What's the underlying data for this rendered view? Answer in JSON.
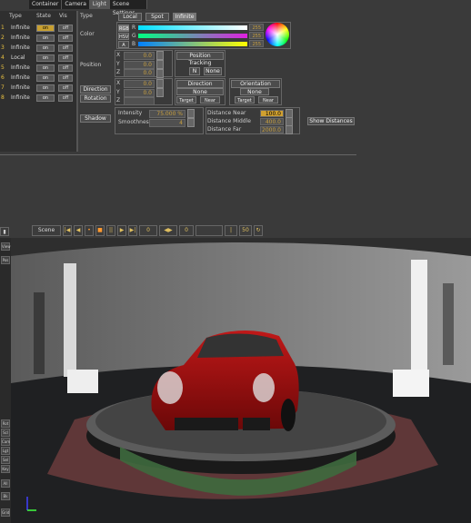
{
  "tabs": [
    {
      "label": "Container"
    },
    {
      "label": "Camera"
    },
    {
      "label": "Light"
    },
    {
      "label": "Scene Settings"
    }
  ],
  "light_list": {
    "headers": [
      "Type",
      "State",
      "Vis"
    ],
    "rows": [
      {
        "index": "1",
        "type": "Infinite",
        "state": "on",
        "vis": "off"
      },
      {
        "index": "2",
        "type": "Infinite",
        "state": "on",
        "vis": "off"
      },
      {
        "index": "3",
        "type": "Infinite",
        "state": "on",
        "vis": "off"
      },
      {
        "index": "4",
        "type": "Local",
        "state": "on",
        "vis": "off"
      },
      {
        "index": "5",
        "type": "Infinite",
        "state": "on",
        "vis": "off"
      },
      {
        "index": "6",
        "type": "Infinite",
        "state": "on",
        "vis": "off"
      },
      {
        "index": "7",
        "type": "Infinite",
        "state": "on",
        "vis": "off"
      },
      {
        "index": "8",
        "type": "Infinite",
        "state": "on",
        "vis": "off"
      }
    ]
  },
  "props": {
    "type_label": "Type",
    "type_buttons": [
      "Local",
      "Spot",
      "Infinite"
    ],
    "color_label": "Color",
    "color_modes": [
      "RGB",
      "HSV",
      "A"
    ],
    "color_channels": [
      {
        "name": "R",
        "value": "255"
      },
      {
        "name": "G",
        "value": "255"
      },
      {
        "name": "B",
        "value": "255"
      }
    ],
    "position_label": "Position",
    "position": {
      "x": "0.0",
      "y": "0.0",
      "z": "0.0"
    },
    "position_tracking_label": "Position Tracking",
    "position_tracking_buttons": [
      "N",
      "None"
    ],
    "direction_button": "Direction",
    "rotation_button": "Rotation",
    "rotation": {
      "x": "0.0",
      "y": "0.0",
      "z": ""
    },
    "direction_tracking_label": "Direction Tracking",
    "direction_tracking_value": "None",
    "direction_tracking_buttons": [
      "Target",
      "Near"
    ],
    "orientation_tracking_label": "Orientation Tracking",
    "orientation_tracking_value": "None",
    "orientation_tracking_buttons": [
      "Target",
      "Near"
    ],
    "shadow_button": "Shadow",
    "intensity_label": "Intensity",
    "intensity_value": "75.000 %",
    "smoothness_label": "Smoothness",
    "smoothness_value": "4",
    "distance_near_label": "Distance Near",
    "distance_near_value": "100.0",
    "distance_middle_label": "Distance Middle",
    "distance_middle_value": "400.0",
    "distance_far_label": "Distance Far",
    "distance_far_value": "2000.0",
    "show_distances_button": "Show Distances"
  },
  "viewport_toolbar": {
    "view_select": "Scene",
    "frame_value": "0",
    "end_value": "50",
    "current_value": "0"
  },
  "left_tools": [
    "View",
    "Pos",
    "Rot",
    "Scl",
    "Cam",
    "Lgt",
    "Sel",
    "Key",
    "All",
    "Bk",
    "Grid"
  ],
  "colors": {
    "accent": "#e8c040",
    "highlight": "#d0a030",
    "car": "#a01010"
  }
}
